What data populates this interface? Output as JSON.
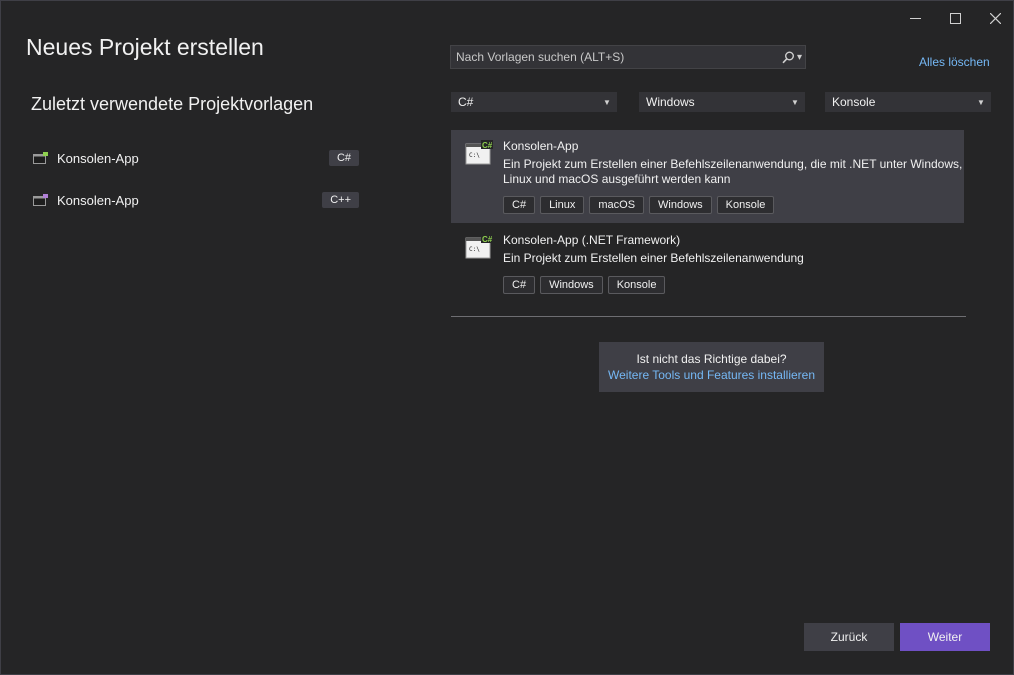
{
  "window": {
    "title": "Neues Projekt erstellen"
  },
  "recent": {
    "heading": "Zuletzt verwendete Projektvorlagen",
    "items": [
      {
        "label": "Konsolen-App",
        "tag": "C#"
      },
      {
        "label": "Konsolen-App",
        "tag": "C++"
      }
    ]
  },
  "search": {
    "placeholder": "Nach Vorlagen suchen (ALT+S)"
  },
  "clear_all": "Alles löschen",
  "filters": {
    "language": "C#",
    "platform": "Windows",
    "project_type": "Konsole"
  },
  "templates": [
    {
      "name": "Konsolen-App",
      "description": "Ein Projekt zum Erstellen einer Befehlszeilenanwendung, die mit .NET unter Windows, Linux und macOS ausgeführt werden kann",
      "tags": [
        "C#",
        "Linux",
        "macOS",
        "Windows",
        "Konsole"
      ],
      "badge": "C#",
      "selected": true
    },
    {
      "name": "Konsolen-App (.NET Framework)",
      "description": "Ein Projekt zum Erstellen einer Befehlszeilenanwendung",
      "tags": [
        "C#",
        "Windows",
        "Konsole"
      ],
      "badge": "C#",
      "selected": false
    }
  ],
  "help": {
    "question": "Ist nicht das Richtige dabei?",
    "link": "Weitere Tools und Features installieren"
  },
  "buttons": {
    "back": "Zurück",
    "next": "Weiter"
  },
  "colors": {
    "background": "#252526",
    "accent": "#6f50c4",
    "link": "#75b8f5",
    "badge_green": "#8fd14f"
  },
  "icons": {
    "minimize": "minimize-icon",
    "maximize": "maximize-icon",
    "close": "close-icon",
    "search": "search-icon",
    "dropdown": "chevron-down-icon",
    "console": "console-app-icon"
  }
}
